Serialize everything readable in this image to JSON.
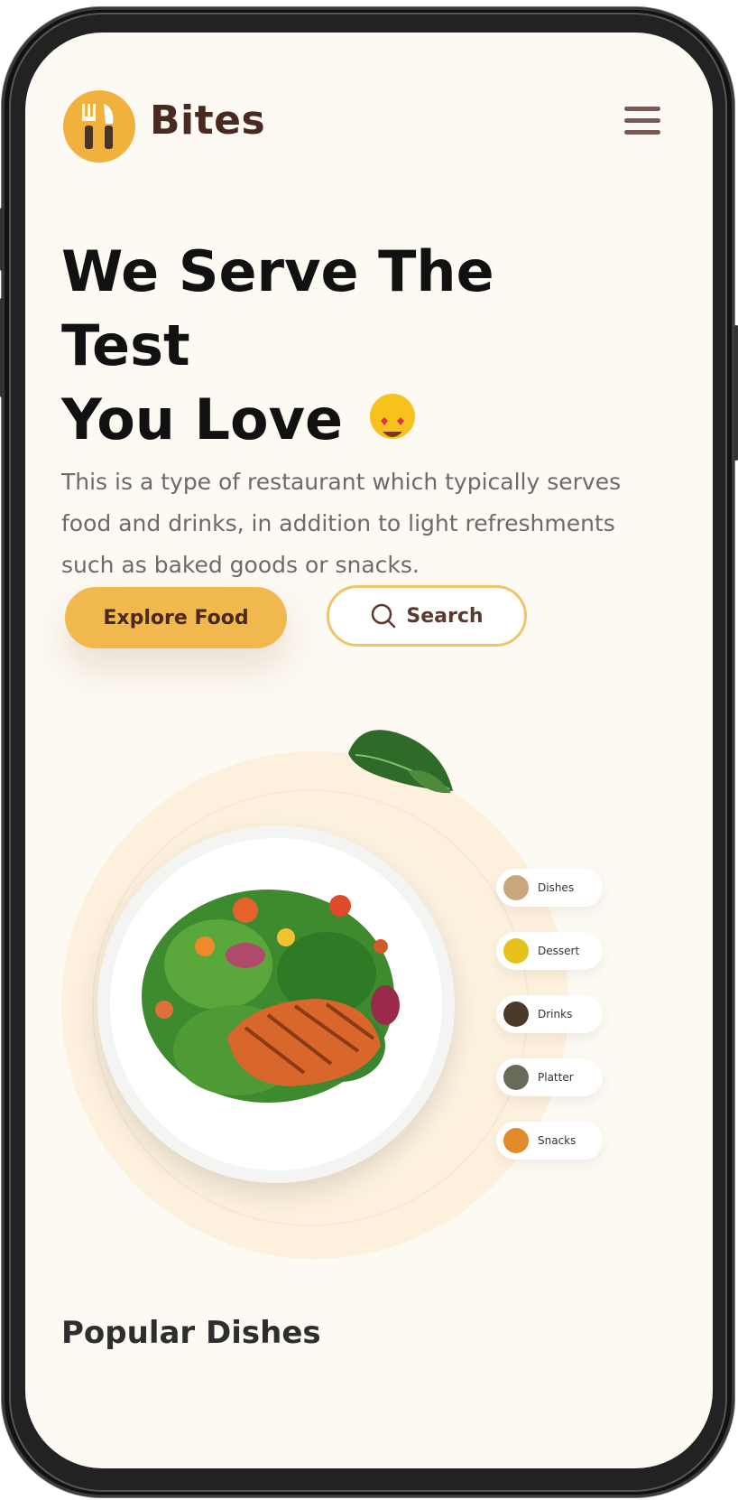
{
  "header": {
    "brand": "Bites",
    "logo_icon": "fork-knife-icon",
    "menu_icon": "hamburger-menu-icon"
  },
  "hero": {
    "title_line1": "We Serve The Test",
    "title_line2": "You Love",
    "emoji_icon": "heart-eyes-emoji-icon",
    "description": "This is a type of restaurant which typically serves food and drinks, in addition to light refreshments such as baked goods or snacks."
  },
  "actions": {
    "explore_label": "Explore Food",
    "search_label": "Search",
    "search_icon": "search-icon"
  },
  "categories": [
    {
      "label": "Dishes",
      "icon": "dishes-icon",
      "color": "#c9a77a"
    },
    {
      "label": "Dessert",
      "icon": "dessert-icon",
      "color": "#e6c21a"
    },
    {
      "label": "Drinks",
      "icon": "drinks-icon",
      "color": "#4a3a2a"
    },
    {
      "label": "Platter",
      "icon": "platter-icon",
      "color": "#6a6a5a"
    },
    {
      "label": "Snacks",
      "icon": "snacks-icon",
      "color": "#e08a2a"
    }
  ],
  "popular": {
    "title": "Popular Dishes"
  },
  "colors": {
    "accent": "#f0b84d",
    "brand_text": "#4a2a20",
    "background": "#fdf9f3"
  }
}
